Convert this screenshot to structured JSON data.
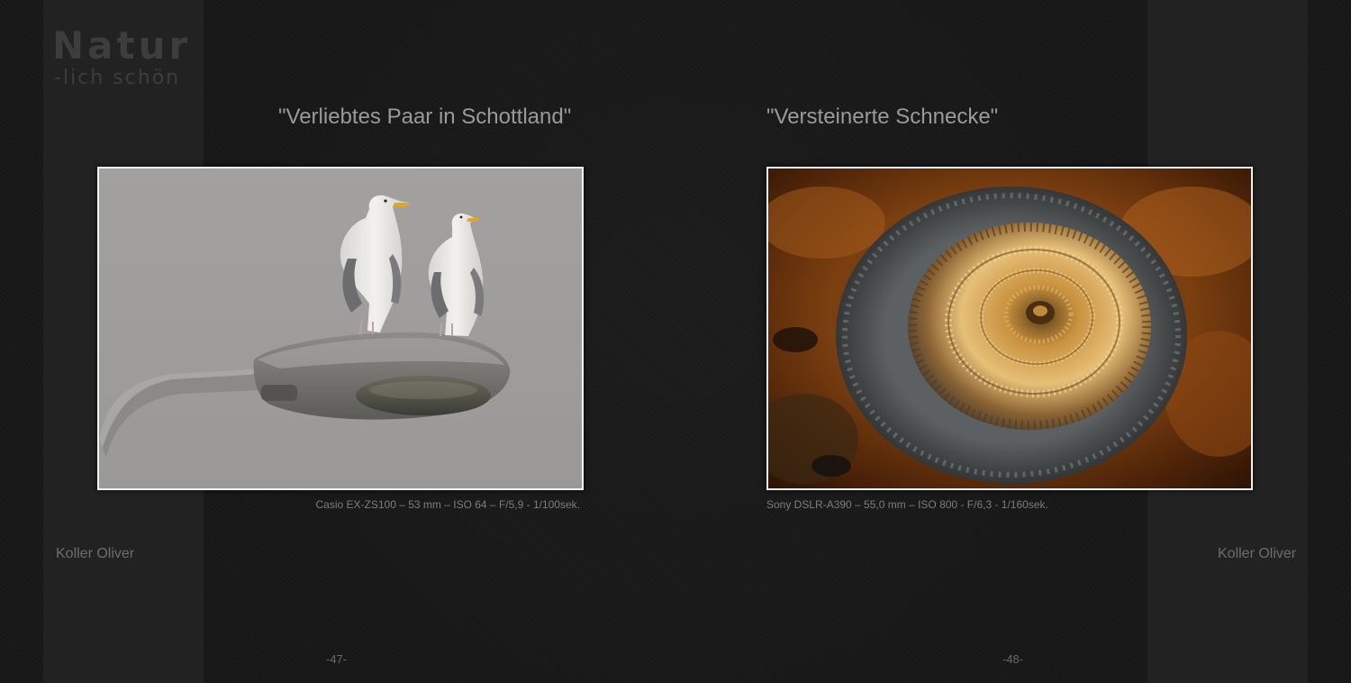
{
  "logo": {
    "main": "Natur",
    "sub": "-lich schön"
  },
  "pages": [
    {
      "title": "\"Verliebtes Paar in Schottland\"",
      "caption": "Casio EX-ZS100 – 53 mm – ISO 64 – F/5,9 - 1/100sek.",
      "page_number": "-47-",
      "author": "Koller Oliver"
    },
    {
      "title": "\"Versteinerte Schnecke\"",
      "caption": "Sony DSLR-A390 – 55,0 mm – ISO 800 - F/6,3 - 1/160sek.",
      "page_number": "-48-",
      "author": "Koller Oliver"
    }
  ],
  "colors": {
    "background": "#181818",
    "side_band": "#222222",
    "title_text": "#9a9a9a",
    "caption_text": "#7d7d7d",
    "frame_border": "#f2f2f2"
  }
}
